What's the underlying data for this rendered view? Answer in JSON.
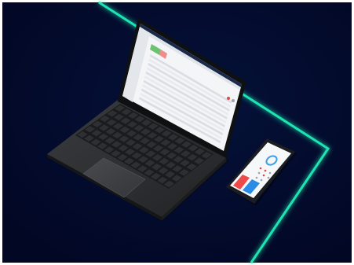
{
  "colors": {
    "frame": "#ffffff",
    "background": "#020b2a",
    "accent_glow": "#1de4b2",
    "laptop_body": "#2b2c2e",
    "laptop_keys": "#161718",
    "screen_bg": "#f4f5f7",
    "app_header": "#1b2a4a",
    "phone_body": "#1c1d20",
    "phone_button_red": "#ef4a4a",
    "phone_button_blue": "#2b8ce6",
    "phone_ring": "#3aa0e8"
  },
  "devices": {
    "laptop": {
      "screen_icon": "monitoring-dashboard",
      "trackpad_icon": "trackpad"
    },
    "phone": {
      "screen_icon": "status-gauge"
    }
  }
}
